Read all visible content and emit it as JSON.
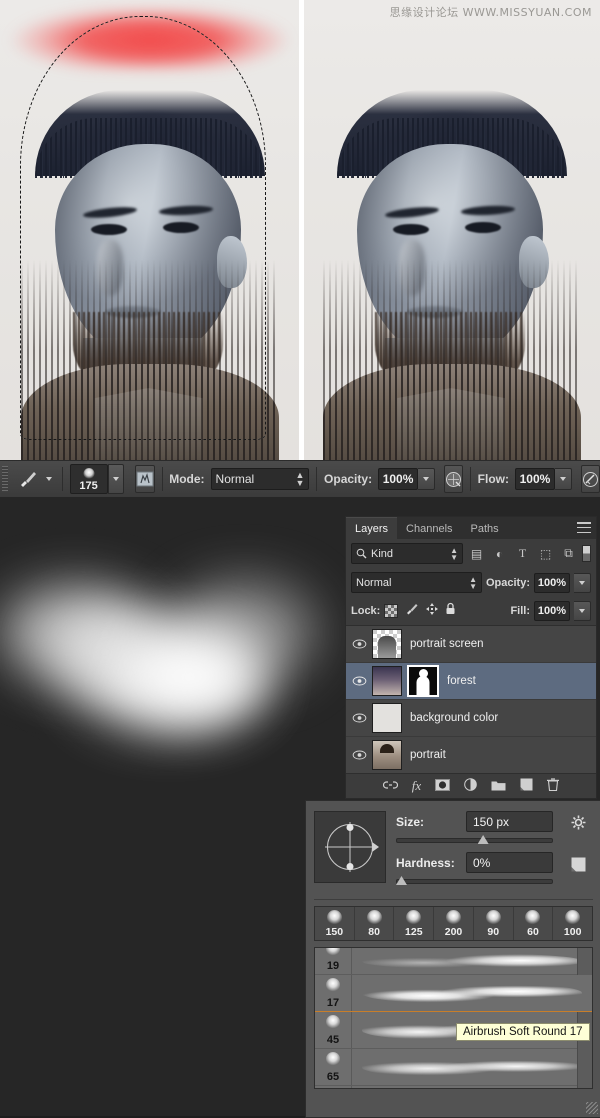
{
  "watermark": "思缘设计论坛 WWW.MISSYUAN.COM",
  "options_bar": {
    "brush_tool_icon": "brush-icon",
    "brush_size": "175",
    "brush_panel_toggle_icon": "brush-panel-icon",
    "mode_label": "Mode:",
    "mode_value": "Normal",
    "opacity_label": "Opacity:",
    "opacity_value": "100%",
    "airbrush_icon": "airbrush-icon",
    "flow_label": "Flow:",
    "flow_value": "100%",
    "tablet_pressure_icon": "tablet-pressure-icon"
  },
  "layers_panel": {
    "tabs": [
      {
        "label": "Layers",
        "active": true
      },
      {
        "label": "Channels",
        "active": false
      },
      {
        "label": "Paths",
        "active": false
      }
    ],
    "filter": {
      "kind_label": "Kind",
      "icons": [
        "pixel-filter-icon",
        "adjustment-filter-icon",
        "type-filter-icon",
        "shape-filter-icon",
        "smart-object-filter-icon"
      ]
    },
    "blend_mode": "Normal",
    "opacity_label": "Opacity:",
    "opacity_value": "100%",
    "lock_label": "Lock:",
    "lock_icons": [
      "lock-transparency-icon",
      "lock-image-icon",
      "lock-position-icon",
      "lock-all-icon"
    ],
    "fill_label": "Fill:",
    "fill_value": "100%",
    "layers": [
      {
        "name": "portrait screen",
        "selected": false,
        "has_mask": false,
        "visible": true
      },
      {
        "name": "forest",
        "selected": true,
        "has_mask": true,
        "visible": true
      },
      {
        "name": "background color",
        "selected": false,
        "has_mask": false,
        "visible": true
      },
      {
        "name": "portrait",
        "selected": false,
        "has_mask": false,
        "visible": true
      }
    ],
    "footer_icons": [
      "link-icon",
      "fx-icon",
      "add-mask-icon",
      "adjustment-layer-icon",
      "new-group-icon",
      "new-layer-icon",
      "delete-layer-icon"
    ]
  },
  "brush_panel": {
    "size_label": "Size:",
    "size_value": "150 px",
    "hardness_label": "Hardness:",
    "hardness_value": "0%",
    "gear_icon": "gear-icon",
    "new_preset_icon": "new-preset-icon",
    "size_slider_percent": 52,
    "hardness_slider_percent": 0,
    "quick_presets": [
      "150",
      "80",
      "125",
      "200",
      "90",
      "60",
      "100"
    ],
    "brush_list": [
      {
        "size": "19",
        "selected": false
      },
      {
        "size": "17",
        "selected": true
      },
      {
        "size": "45",
        "selected": false
      },
      {
        "size": "65",
        "selected": false
      }
    ],
    "tooltip": "Airbrush Soft Round 17"
  },
  "colors": {
    "panel_bg": "#3c3c3c",
    "brush_panel_bg": "#535353",
    "selected_layer": "#5d6b80",
    "selection_highlight": "#c87e2a",
    "tooltip_bg": "#feffd6",
    "paint_red": "#f24242",
    "canvas_dark": "#262626"
  }
}
